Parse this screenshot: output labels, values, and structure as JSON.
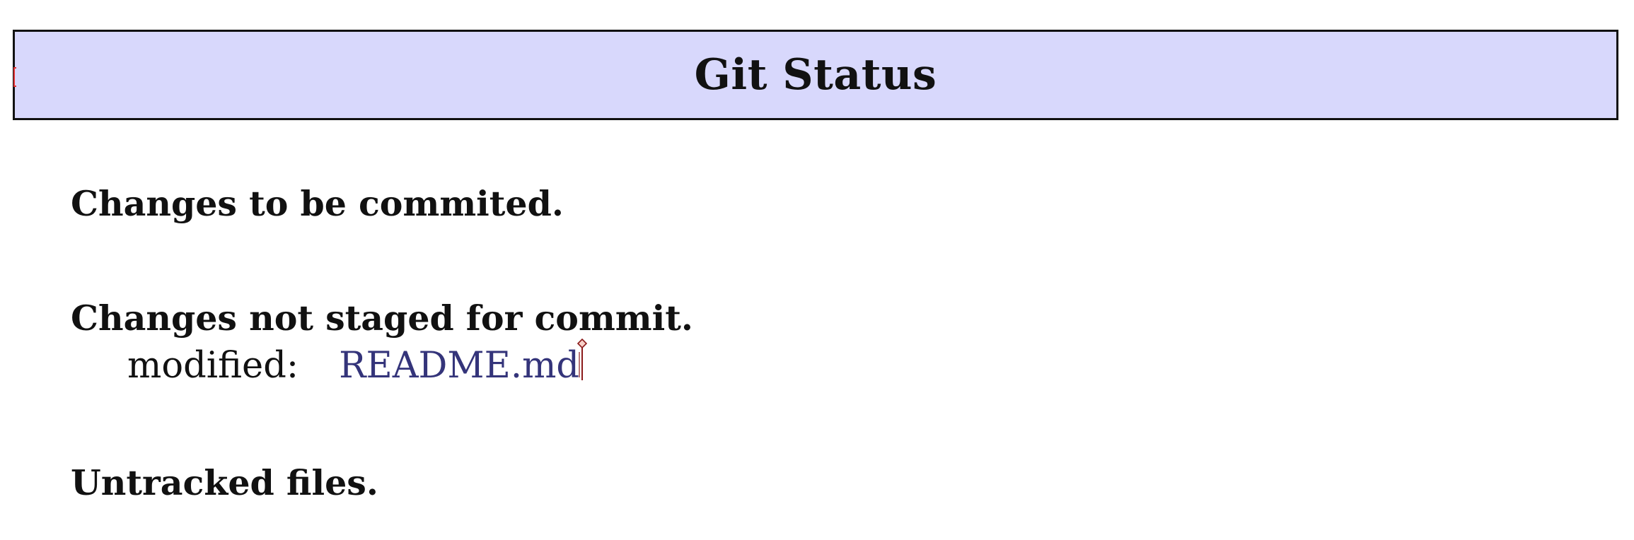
{
  "header": {
    "title": "Git Status"
  },
  "sections": {
    "staged": {
      "heading": "Changes to be commited."
    },
    "unstaged": {
      "heading": "Changes not staged for commit.",
      "changes": [
        {
          "status": "modified:",
          "file": "README.md"
        }
      ]
    },
    "untracked": {
      "heading": "Untracked files."
    }
  },
  "icons": {
    "text_cursor": "text-cursor-icon",
    "pencil": "pencil-icon"
  },
  "colors": {
    "header_background": "#d8d8fc",
    "file_link": "#34347a",
    "cursor_mark": "#e03030"
  }
}
